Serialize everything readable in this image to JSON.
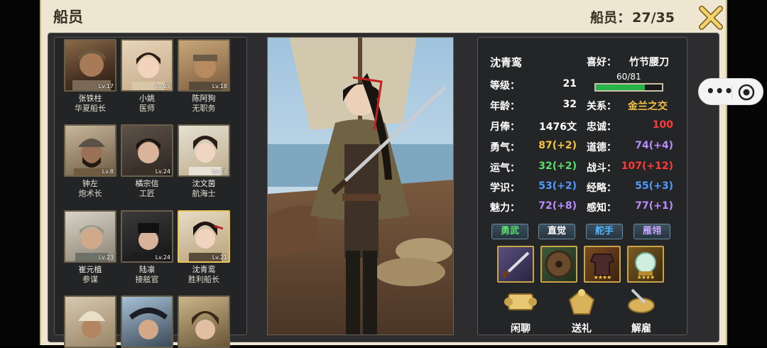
{
  "header": {
    "title": "船员",
    "count_label": "船员：",
    "count_value": "27/35"
  },
  "crew": [
    {
      "name": "张铁柱",
      "role": "华夏船长",
      "level": "Lv.17"
    },
    {
      "name": "小姚",
      "role": "医师",
      "level": "Lv.25"
    },
    {
      "name": "陈阿狗",
      "role": "无职务",
      "level": "Lv.18"
    },
    {
      "name": "钟左",
      "role": "炮术长",
      "level": "Lv.8"
    },
    {
      "name": "橘宗信",
      "role": "工匠",
      "level": "Lv.24"
    },
    {
      "name": "沈文茵",
      "role": "航海士",
      "level": "Lv.24"
    },
    {
      "name": "崔元植",
      "role": "参谋",
      "level": "Lv.23"
    },
    {
      "name": "陆凛",
      "role": "接舷官",
      "level": "Lv.24"
    },
    {
      "name": "沈青鸾",
      "role": "胜利船长",
      "level": "Lv.21"
    },
    {
      "name": "",
      "role": "",
      "level": ""
    },
    {
      "name": "",
      "role": "",
      "level": ""
    },
    {
      "name": "",
      "role": "",
      "level": ""
    }
  ],
  "selected": {
    "name": "沈青鸾",
    "hobby_label": "喜好：",
    "hobby": "竹节腰刀",
    "level_label": "等级：",
    "level": "21",
    "exp_text": "60/81",
    "exp_fraction": 0.74,
    "age_label": "年龄：",
    "age": "32",
    "relation_label": "关系：",
    "relation": "金兰之交",
    "salary_label": "月俸：",
    "salary": "1476文",
    "loyalty_label": "忠诚：",
    "loyalty": "100",
    "courage_label": "勇气：",
    "courage": "87(+2)",
    "morality_label": "道德：",
    "morality": "74(+4)",
    "luck_label": "运气：",
    "luck": "32(+2)",
    "combat_label": "战斗：",
    "combat": "107(+12)",
    "knowledge_label": "学识：",
    "knowledge": "53(+2)",
    "strategy_label": "经略：",
    "strategy": "55(+3)",
    "charm_label": "魅力：",
    "charm": "72(+8)",
    "perception_label": "感知：",
    "perception": "77(+1)"
  },
  "skills": [
    {
      "label": "勇武",
      "color": "#58e06a"
    },
    {
      "label": "直觉",
      "color": "#ffffff"
    },
    {
      "label": "舵手",
      "color": "#4fb8ff"
    },
    {
      "label": "雁翎",
      "color": "#c9a8ff"
    }
  ],
  "equipment": [
    {
      "icon": "sword-icon",
      "stars": ""
    },
    {
      "icon": "shield-icon",
      "stars": ""
    },
    {
      "icon": "armor-icon",
      "stars": "★★★★"
    },
    {
      "icon": "pearl-icon",
      "stars": "★★★★"
    }
  ],
  "actions": [
    {
      "label": "闲聊",
      "icon": "scroll-icon"
    },
    {
      "label": "送礼",
      "icon": "gift-icon"
    },
    {
      "label": "解雇",
      "icon": "dismiss-icon"
    }
  ],
  "colors": {
    "gold": "#f5c542",
    "red": "#ff3a3a",
    "yellow": "#f5c542",
    "green": "#58e06a",
    "blue": "#4f9bff",
    "purple": "#b98cff",
    "exp_green": "#27b34a"
  }
}
